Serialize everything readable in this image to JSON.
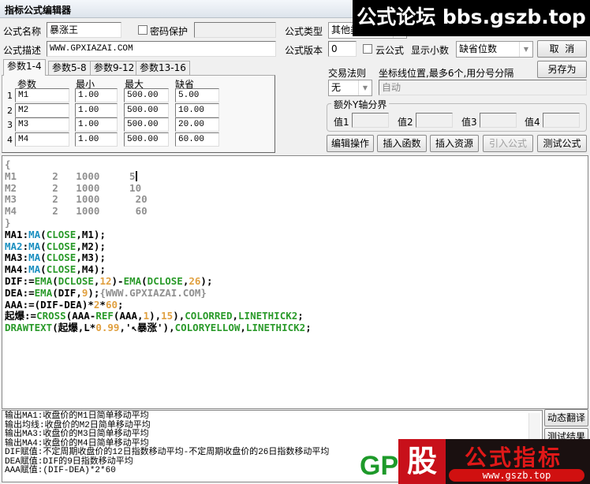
{
  "window": {
    "title": "指标公式编辑器"
  },
  "form": {
    "name_label": "公式名称",
    "name_value": "暴涨王",
    "password_label": "密码保护",
    "type_label": "公式类型",
    "type_value": "其他类",
    "desc_label": "公式描述",
    "desc_value": "WWW.GPXIAZAI.COM",
    "version_label": "公式版本",
    "version_value": "0",
    "cloud_label": "云公式",
    "decimals_label": "显示小数",
    "decimals_value": "缺省位数",
    "cancel_label": "取  消",
    "saveas_label": "另存为",
    "trade_label": "交易法则",
    "trade_value": "无",
    "axis_label": "坐标线位置,最多6个,用分号分隔",
    "axis_value": "自动",
    "yaxis_group": "额外Y轴分界",
    "yvals": [
      "值1",
      "值2",
      "值3",
      "值4"
    ]
  },
  "tabs": [
    "参数1-4",
    "参数5-8",
    "参数9-12",
    "参数13-16"
  ],
  "params": {
    "headers": [
      "参数",
      "最小",
      "最大",
      "缺省"
    ],
    "rows": [
      {
        "idx": "1",
        "name": "M1",
        "min": "1.00",
        "max": "500.00",
        "def": "5.00"
      },
      {
        "idx": "2",
        "name": "M2",
        "min": "1.00",
        "max": "500.00",
        "def": "10.00"
      },
      {
        "idx": "3",
        "name": "M3",
        "min": "1.00",
        "max": "500.00",
        "def": "20.00"
      },
      {
        "idx": "4",
        "name": "M4",
        "min": "1.00",
        "max": "500.00",
        "def": "60.00"
      }
    ]
  },
  "actions": [
    "编辑操作",
    "插入函数",
    "插入资源",
    "引入公式",
    "测试公式"
  ],
  "code_lines": [
    [
      [
        "{",
        "c"
      ]
    ],
    [
      [
        "M1      2   1000     5",
        "c"
      ]
    ],
    [
      [
        "M2      2   1000     10",
        "c"
      ]
    ],
    [
      [
        "M3      2   1000      20",
        "c"
      ]
    ],
    [
      [
        "M4      2   1000      60",
        "c"
      ]
    ],
    [
      [
        "}",
        "c"
      ]
    ],
    [
      [
        "MA1:",
        "k"
      ],
      [
        "MA",
        "f"
      ],
      [
        "(",
        "k"
      ],
      [
        "CLOSE",
        "g"
      ],
      [
        ",M1);",
        "k"
      ]
    ],
    [
      [
        "MA2",
        "f"
      ],
      [
        ":",
        "k"
      ],
      [
        "MA",
        "f"
      ],
      [
        "(",
        "k"
      ],
      [
        "CLOSE",
        "g"
      ],
      [
        ",M2);",
        "k"
      ]
    ],
    [
      [
        "MA3:",
        "k"
      ],
      [
        "MA",
        "f"
      ],
      [
        "(",
        "k"
      ],
      [
        "CLOSE",
        "g"
      ],
      [
        ",M3);",
        "k"
      ]
    ],
    [
      [
        "MA4:",
        "k"
      ],
      [
        "MA",
        "f"
      ],
      [
        "(",
        "k"
      ],
      [
        "CLOSE",
        "g"
      ],
      [
        ",M4);",
        "k"
      ]
    ],
    [
      [
        "DIF:=",
        "k"
      ],
      [
        "EMA",
        "g"
      ],
      [
        "(",
        "k"
      ],
      [
        "DCLOSE",
        "g"
      ],
      [
        ",",
        "k"
      ],
      [
        "12",
        "n"
      ],
      [
        ")-",
        "k"
      ],
      [
        "EMA",
        "g"
      ],
      [
        "(",
        "k"
      ],
      [
        "DCLOSE",
        "g"
      ],
      [
        ",",
        "k"
      ],
      [
        "26",
        "n"
      ],
      [
        ");",
        "k"
      ]
    ],
    [
      [
        "DEA:=",
        "k"
      ],
      [
        "EMA",
        "g"
      ],
      [
        "(DIF,",
        "k"
      ],
      [
        "9",
        "n"
      ],
      [
        ");",
        "k"
      ],
      [
        "{WWW.GPXIAZAI.COM}",
        "c"
      ]
    ],
    [
      [
        "AAA:=(DIF-DEA)*",
        "k"
      ],
      [
        "2",
        "n"
      ],
      [
        "*",
        "k"
      ],
      [
        "60",
        "n"
      ],
      [
        ";",
        "k"
      ]
    ],
    [
      [
        "起爆:=",
        "k"
      ],
      [
        "CROSS",
        "g"
      ],
      [
        "(AAA-",
        "k"
      ],
      [
        "REF",
        "g"
      ],
      [
        "(AAA,",
        "k"
      ],
      [
        "1",
        "n"
      ],
      [
        "),",
        "k"
      ],
      [
        "15",
        "n"
      ],
      [
        "),",
        "k"
      ],
      [
        "COLORRED",
        "g"
      ],
      [
        ",",
        "k"
      ],
      [
        "LINETHICK2",
        "g"
      ],
      [
        ";",
        "k"
      ]
    ],
    [
      [
        "DRAWTEXT",
        "g"
      ],
      [
        "(起爆,L*",
        "k"
      ],
      [
        "0.99",
        "n"
      ],
      [
        ",'↖暴涨'),",
        "k"
      ],
      [
        "COLORYELLOW",
        "g"
      ],
      [
        ",",
        "k"
      ],
      [
        "LINETHICK2",
        "g"
      ],
      [
        ";",
        "k"
      ]
    ]
  ],
  "output_lines": [
    "输出MA1:收盘价的M1日简单移动平均",
    "输出均线:收盘价的M2日简单移动平均",
    "输出MA3:收盘价的M3日简单移动平均",
    "输出MA4:收盘价的M4日简单移动平均",
    "DIF赋值:不定周期收盘价的12日指数移动平均-不定周期收盘价的26日指数移动平均",
    "DEA赋值:DIF的9日指数移动平均",
    "AAA赋值:(DIF-DEA)*2*60"
  ],
  "side_buttons": [
    "动态翻译",
    "测试结果"
  ],
  "watermarks": {
    "top": "公式论坛 bbs.gszb.top",
    "gp": "GP",
    "gu": "股",
    "brand": "公式指标",
    "url": "www.gszb.top"
  }
}
